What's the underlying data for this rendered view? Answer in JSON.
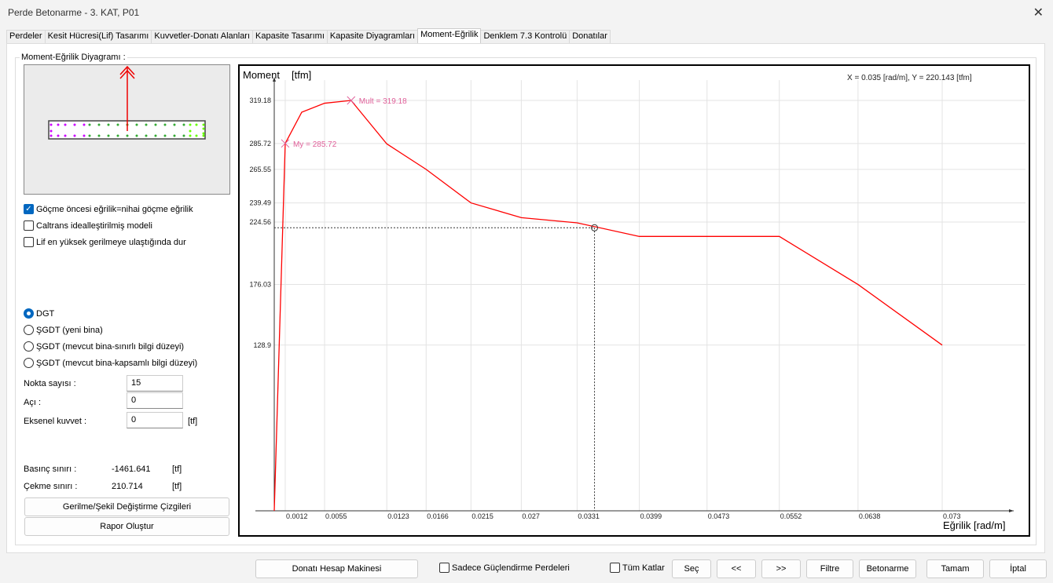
{
  "window": {
    "title": "Perde Betonarme - 3. KAT, P01"
  },
  "tabs": [
    "Perdeler",
    "Kesit Hücresi(Lif) Tasarımı",
    "Kuvvetler-Donatı Alanları",
    "Kapasite Tasarımı",
    "Kapasite Diyagramları",
    "Moment-Eğrilik",
    "Denklem 7.3 Kontrolü",
    "Donatılar"
  ],
  "active_tab": "Moment-Eğrilik",
  "group_label": "Moment-Eğrilik Diyagramı :",
  "checkboxes": [
    {
      "label": "Göçme öncesi eğrilik=nihai göçme eğrilik",
      "checked": true
    },
    {
      "label": "Caltrans idealleştirilmiş modeli",
      "checked": false
    },
    {
      "label": "Lif en yüksek gerilmeye ulaştığında dur",
      "checked": false
    }
  ],
  "radios": [
    {
      "label": "DGT",
      "selected": true
    },
    {
      "label": "ŞGDT (yeni bina)",
      "selected": false
    },
    {
      "label": "ŞGDT (mevcut bina-sınırlı bilgi düzeyi)",
      "selected": false
    },
    {
      "label": "ŞGDT (mevcut bina-kapsamlı bilgi düzeyi)",
      "selected": false
    }
  ],
  "fields": {
    "nokta_label": "Nokta sayısı :",
    "nokta": "15",
    "aci_label": "Açı :",
    "aci": "0",
    "eksenel_label": "Eksenel kuvvet :",
    "eksenel": "0",
    "eksenel_unit": "[tf]"
  },
  "limits": {
    "basinc_label": "Basınç sınırı :",
    "basinc": "-1461.641",
    "basinc_unit": "[tf]",
    "cekme_label": "Çekme sınırı :",
    "cekme": "210.714",
    "cekme_unit": "[tf]"
  },
  "buttons": {
    "gerilme": "Gerilme/Şekil Değiştirme Çizgileri",
    "rapor": "Rapor Oluştur"
  },
  "footer": {
    "hesap": "Donatı Hesap Makinesi",
    "sadece": "Sadece Güçlendirme Perdeleri",
    "tum": "Tüm Katlar",
    "sec": "Seç",
    "prev": "<<",
    "next": ">>",
    "filtre": "Filtre",
    "betonarme": "Betonarme",
    "tamam": "Tamam",
    "iptal": "İptal"
  },
  "chart_data": {
    "type": "line",
    "ylabel": "Moment",
    "yunit": "[tfm]",
    "xlabel": "Eğrilik [rad/m]",
    "cursor_readout": "X = 0.035 [rad/m],  Y = 220.143 [tfm]",
    "cursor": {
      "x": 0.035,
      "y": 220.143
    },
    "x_ticks": [
      "0.0012",
      "0.0055",
      "0.0123",
      "0.0166",
      "0.0215",
      "0.027",
      "0.0331",
      "0.0399",
      "0.0473",
      "0.0552",
      "0.0638",
      "0.073"
    ],
    "y_ticks": [
      "319.18",
      "285.72",
      "265.55",
      "239.49",
      "224.56",
      "176.03",
      "128.9"
    ],
    "xlim": [
      0,
      0.079
    ],
    "ylim": [
      0,
      335
    ],
    "x": [
      0,
      0.0012,
      0.003,
      0.0055,
      0.0084,
      0.0123,
      0.0166,
      0.0215,
      0.027,
      0.0331,
      0.0399,
      0.0473,
      0.0552,
      0.0638,
      0.073
    ],
    "y": [
      0,
      285.72,
      310,
      317,
      319.18,
      285.4,
      265.55,
      239.49,
      228,
      224,
      213.4,
      213.4,
      213.4,
      176.03,
      128.9
    ],
    "annotations": [
      {
        "label": "My = 285.72",
        "x": 0.0012,
        "y": 285.72
      },
      {
        "label": "Mult = 319.18",
        "x": 0.0084,
        "y": 319.18
      }
    ],
    "line_color": "#ff0000",
    "marker_color": "#e0609a"
  }
}
